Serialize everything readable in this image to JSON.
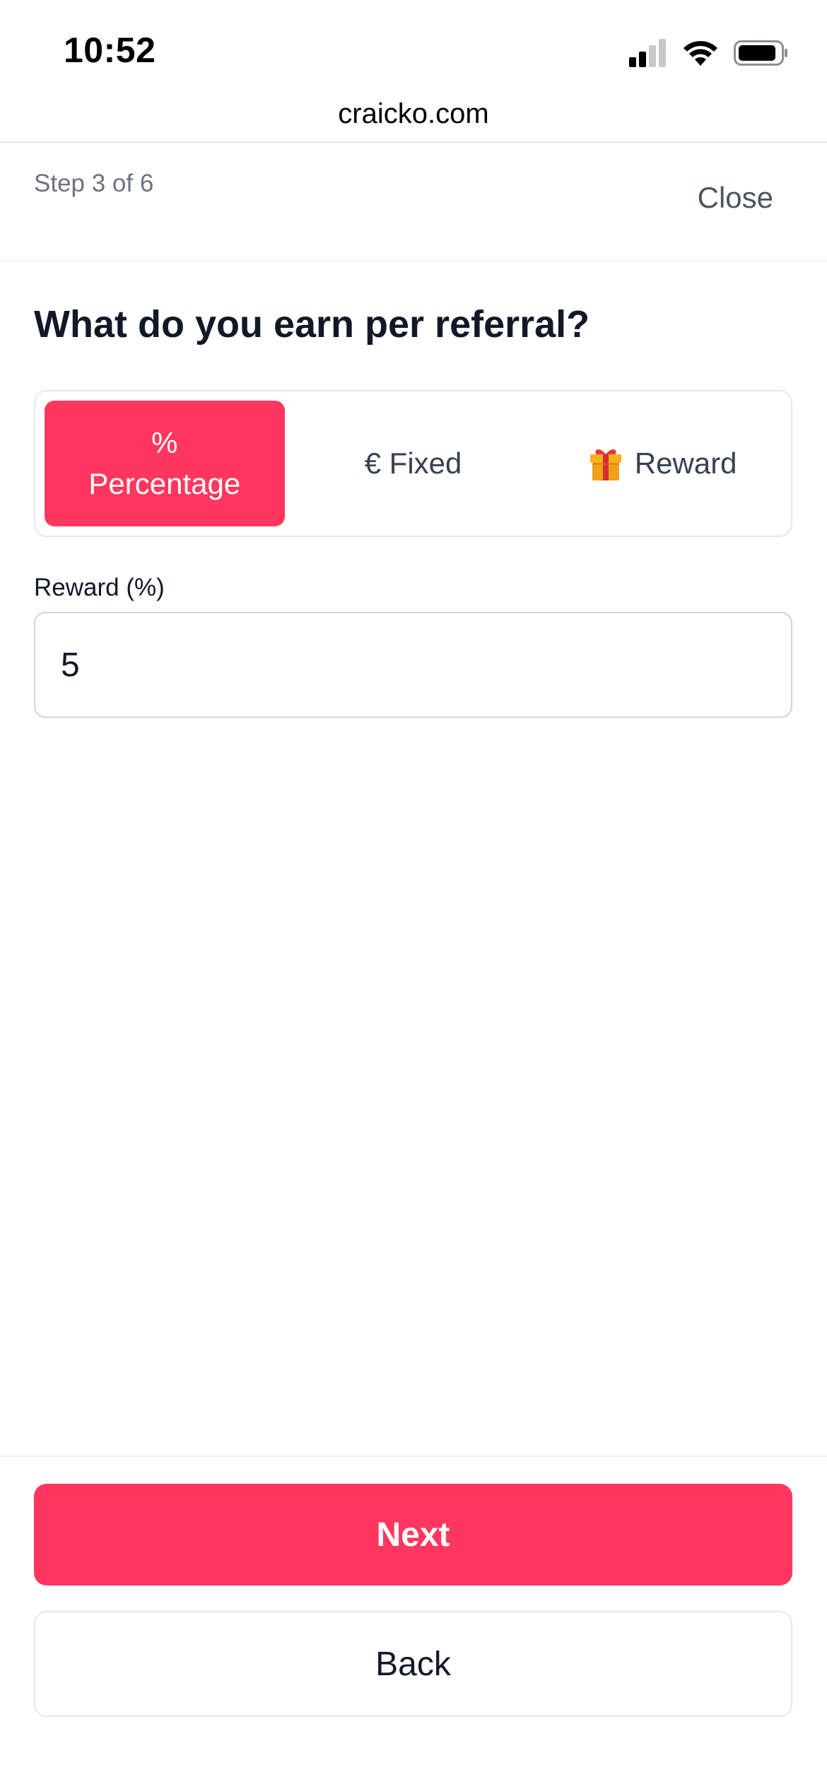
{
  "status_bar": {
    "time": "10:52"
  },
  "browser": {
    "url": "craicko.com"
  },
  "wizard": {
    "step_label": "Step 3 of 6",
    "close_label": "Close"
  },
  "question": {
    "title": "What do you earn per referral?"
  },
  "earning_type": {
    "selected": "percentage",
    "options": [
      {
        "id": "percentage",
        "symbol": "%",
        "label": "Percentage"
      },
      {
        "id": "fixed",
        "label": "€ Fixed"
      },
      {
        "id": "reward",
        "icon": "gift-icon",
        "label": "Reward"
      }
    ]
  },
  "reward_field": {
    "label": "Reward (%)",
    "value": "5"
  },
  "footer": {
    "next_label": "Next",
    "back_label": "Back"
  },
  "colors": {
    "accent": "#ff375f",
    "text_primary": "#111827",
    "text_muted": "#6b7280",
    "border": "#e5e7eb"
  }
}
